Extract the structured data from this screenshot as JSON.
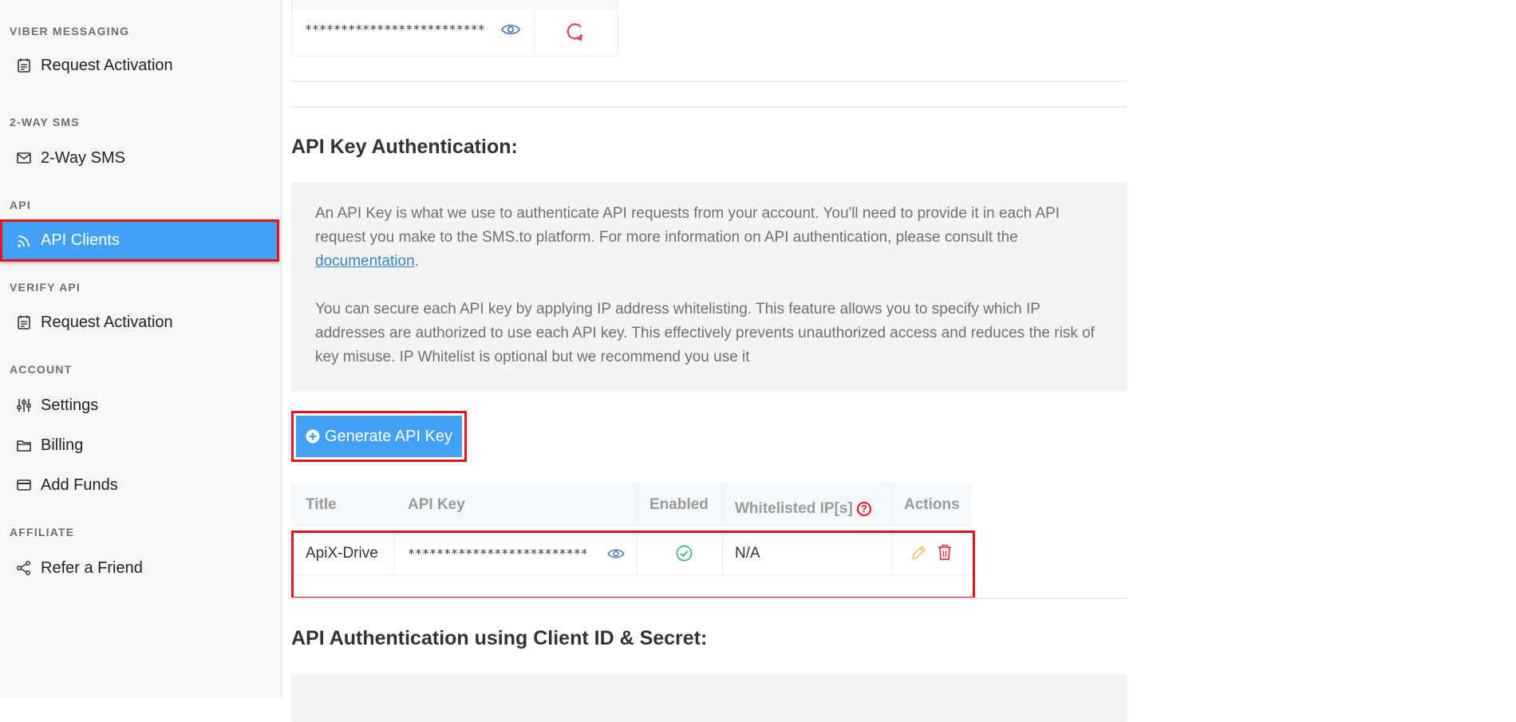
{
  "sidebar": {
    "sections": [
      {
        "heading": "VIBER MESSAGING",
        "items": [
          {
            "label": "Request Activation",
            "icon": "calendar-icon"
          }
        ]
      },
      {
        "heading": "2-WAY SMS",
        "items": [
          {
            "label": "2-Way SMS",
            "icon": "envelope-icon"
          }
        ]
      },
      {
        "heading": "API",
        "items": [
          {
            "label": "API Clients",
            "icon": "rss-icon",
            "active": true
          }
        ]
      },
      {
        "heading": "VERIFY API",
        "items": [
          {
            "label": "Request Activation",
            "icon": "calendar-icon"
          }
        ]
      },
      {
        "heading": "ACCOUNT",
        "items": [
          {
            "label": "Settings",
            "icon": "sliders-icon"
          },
          {
            "label": "Billing",
            "icon": "folder-icon"
          },
          {
            "label": "Add Funds",
            "icon": "credit-card-icon"
          }
        ]
      },
      {
        "heading": "AFFILIATE",
        "items": [
          {
            "label": "Refer a Friend",
            "icon": "share-icon"
          }
        ]
      }
    ]
  },
  "top_table": {
    "masked_key": "*************************"
  },
  "api_key_section": {
    "title": "API Key Authentication:",
    "para1_before": "An API Key is what we use to authenticate API requests from your account. You'll need to provide it in each API request you make to the SMS.to platform. For more information on API authentication, please consult the ",
    "para1_link": "documentation",
    "para1_after": ".",
    "para2": "You can secure each API key by applying IP address whitelisting. This feature allows you to specify which IP addresses are authorized to use each API key. This effectively prevents unauthorized access and reduces the risk of key misuse. IP Whitelist is optional but we recommend you use it",
    "generate_button": "Generate API Key"
  },
  "keys_table": {
    "headers": {
      "title": "Title",
      "api_key": "API Key",
      "enabled": "Enabled",
      "whitelisted": "Whitelisted IP[s]",
      "actions": "Actions"
    },
    "rows": [
      {
        "title": "ApiX-Drive",
        "api_key": "*************************",
        "whitelisted": "N/A"
      }
    ]
  },
  "client_id_section": {
    "title": "API Authentication using Client ID & Secret:"
  },
  "colors": {
    "accent": "#42a0f5",
    "highlight": "#e0151b",
    "success": "#2bb673",
    "edit": "#f0c060"
  }
}
